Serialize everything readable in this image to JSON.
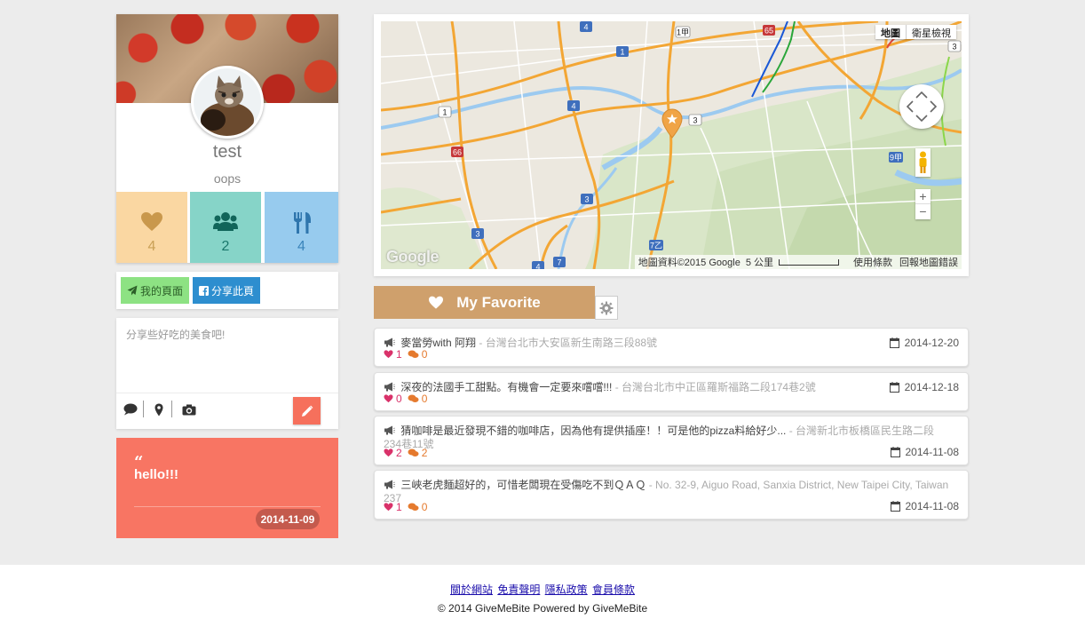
{
  "profile": {
    "name": "test",
    "tagline": "oops",
    "stats": {
      "likes": "4",
      "friends": "2",
      "foods": "4"
    }
  },
  "actions": {
    "my_page": "我的頁面",
    "share_page": "分享此頁"
  },
  "composer": {
    "placeholder": "分享些好吃的美食吧!"
  },
  "quote": {
    "text": "hello!!!",
    "date": "2014-11-09"
  },
  "map": {
    "type_map": "地圖",
    "type_satellite": "衛星檢視",
    "logo": "Google",
    "attribution": "地圖資料©2015 Google",
    "scale": "5 公里",
    "terms": "使用條款",
    "report": "回報地圖錯誤",
    "road_labels": [
      "4",
      "1",
      "1甲",
      "65",
      "3",
      "1",
      "4",
      "3",
      "66",
      "3",
      "3",
      "7乙",
      "4",
      "7",
      "9甲"
    ]
  },
  "favorites": {
    "title": "My Favorite",
    "items": [
      {
        "title": "麥當勞with 阿翔",
        "address": " - 台灣台北市大安區新生南路三段88號",
        "likes": "1",
        "comments": "0",
        "date": "2014-12-20"
      },
      {
        "title": "深夜的法國手工甜點。有機會一定要來嚐嚐!!!",
        "address": " - 台灣台北市中正區羅斯福路二段174巷2號",
        "likes": "0",
        "comments": "0",
        "date": "2014-12-18"
      },
      {
        "title": "猜咖啡是最近發現不錯的咖啡店，因為他有提供插座！！可是他的pizza料給好少...",
        "address": " - 台灣新北市板橋區民生路二段234巷11號",
        "likes": "2",
        "comments": "2",
        "date": "2014-11-08"
      },
      {
        "title": "三峽老虎麵超好的，可惜老闆現在受傷吃不到ＱＡＱ",
        "address": " - No. 32-9, Aiguo Road, Sanxia District, New Taipei City, Taiwan 237",
        "likes": "1",
        "comments": "0",
        "date": "2014-11-08"
      }
    ]
  },
  "footer": {
    "links": [
      "關於網站",
      "免責聲明",
      "隱私政策",
      "會員條款"
    ],
    "copyright": "© 2014 GiveMeBite Powered by GiveMeBite"
  },
  "colors": {
    "likes_tile": "#fad7a2",
    "friends_tile": "#86d4c8",
    "foods_tile": "#97cbee",
    "accent_coral": "#f87563",
    "favorite_tab": "#cfa06c",
    "share_button": "#2d8ecf",
    "mypage_button": "#8de283"
  }
}
